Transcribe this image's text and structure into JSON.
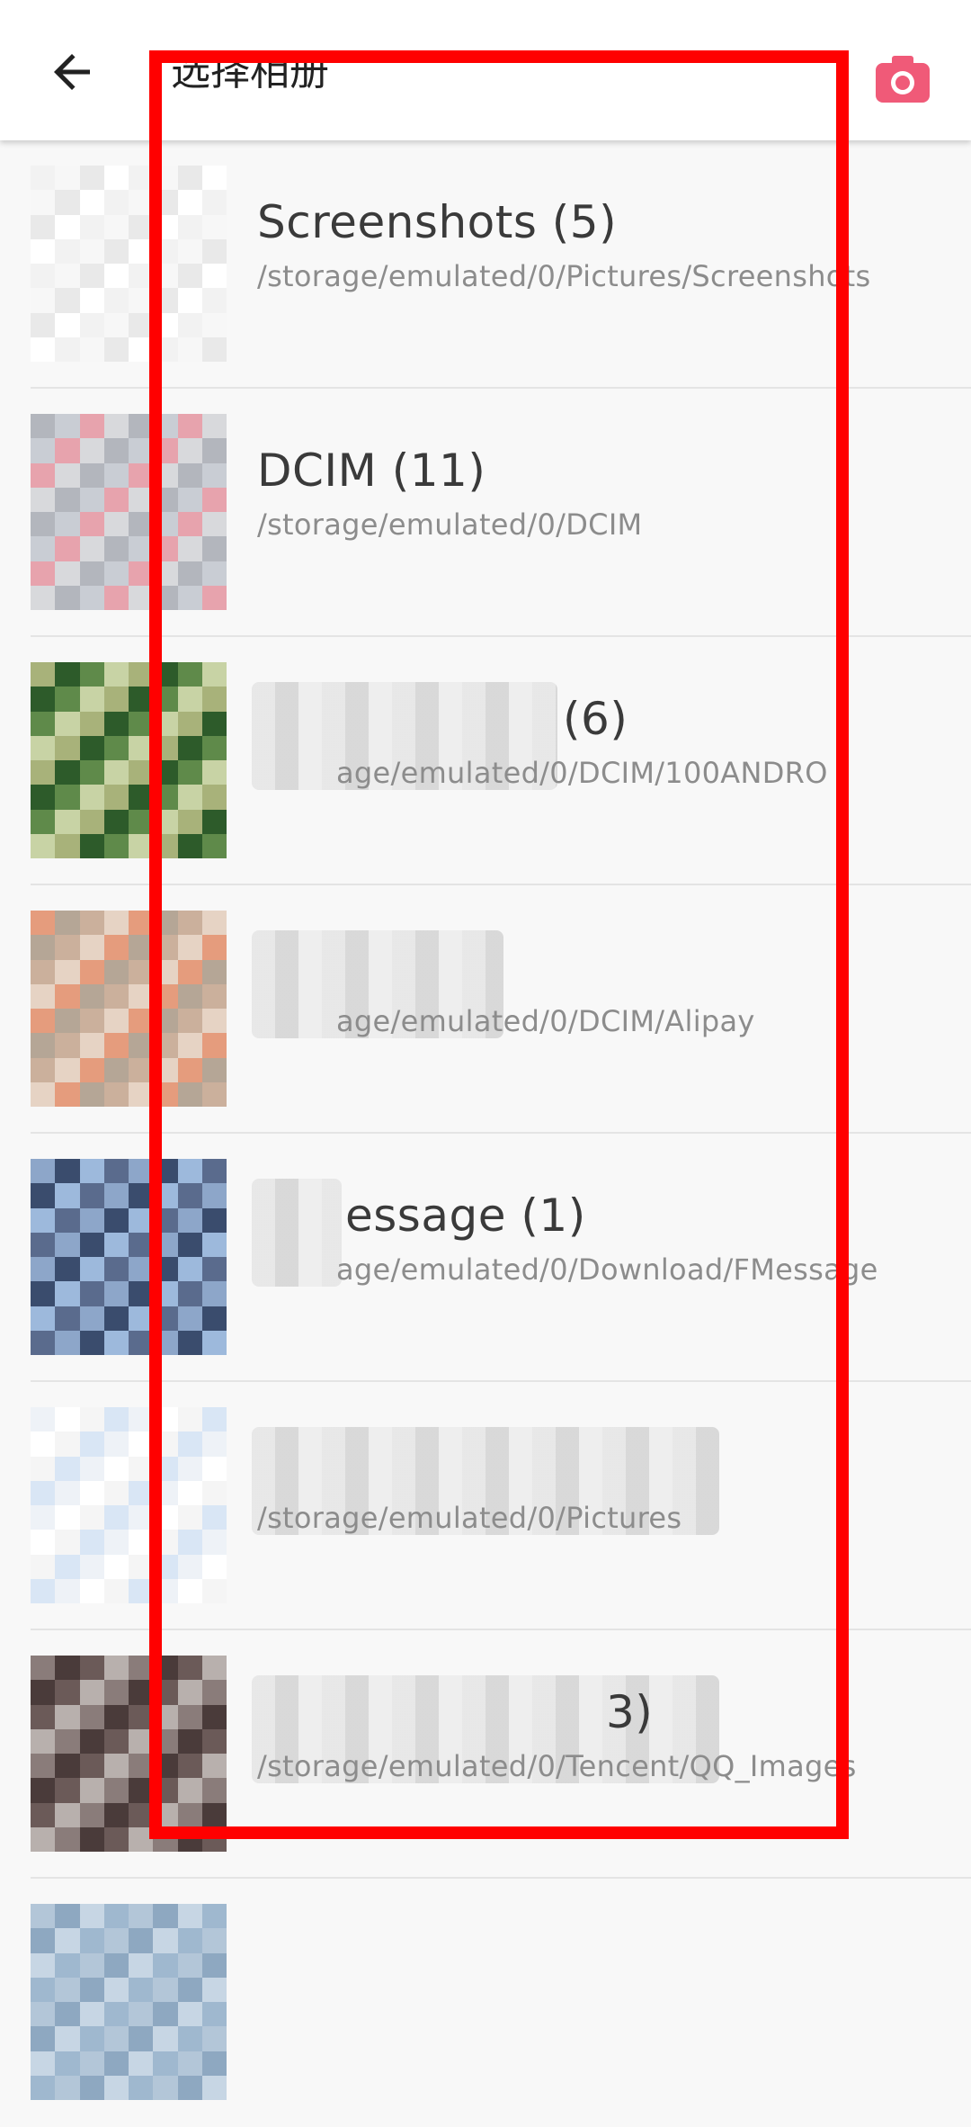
{
  "header": {
    "title": "选择相册",
    "back_icon": "arrow-left-icon",
    "camera_icon": "camera-icon",
    "accent_color": "#f05a78"
  },
  "albums": [
    {
      "name": "Screenshots (5)",
      "path": "/storage/emulated/0/Pictures/Screenshots",
      "thumb_colors": [
        "#f2f2f2",
        "#ffffff",
        "#e9e9e9",
        "#f7f7f7"
      ]
    },
    {
      "name": "DCIM (11)",
      "path": "/storage/emulated/0/DCIM",
      "thumb_colors": [
        "#c9cdd4",
        "#b3b6bd",
        "#d8d9dc",
        "#e7a3ad"
      ]
    },
    {
      "name": "(6)",
      "path": "age/emulated/0/DCIM/100ANDRO",
      "thumb_colors": [
        "#5f8a4a",
        "#2d5b2a",
        "#a8b27a",
        "#c8d3a5"
      ]
    },
    {
      "name": "",
      "path": "age/emulated/0/DCIM/Alipay",
      "thumb_colors": [
        "#e6d3c4",
        "#cbb09c",
        "#b5a696",
        "#e59c7d"
      ]
    },
    {
      "name": "essage (1)",
      "path": "age/emulated/0/Download/FMessage",
      "thumb_colors": [
        "#8da6c9",
        "#5a6b8d",
        "#9db9dc",
        "#3a4c6d"
      ]
    },
    {
      "name": "",
      "path": "/storage/emulated/0/Pictures",
      "thumb_colors": [
        "#ffffff",
        "#eef2f7",
        "#d9e6f5",
        "#f5f5f5"
      ]
    },
    {
      "name": "3)",
      "path": "/storage/emulated/0/Tencent/QQ_Images",
      "thumb_colors": [
        "#6b5a58",
        "#4a3b3a",
        "#8a7c7a",
        "#b8b0ad"
      ]
    },
    {
      "name": "",
      "path": "",
      "thumb_colors": [
        "#9fb8cf",
        "#c7d6e4",
        "#8ea8c1",
        "#b3c6d8"
      ]
    }
  ]
}
